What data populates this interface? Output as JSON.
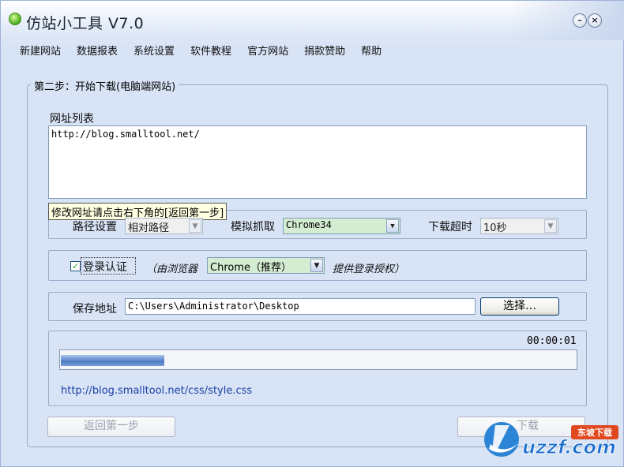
{
  "window": {
    "title": "仿站小工具 V7.0"
  },
  "menu": [
    "新建网站",
    "数据报表",
    "系统设置",
    "软件教程",
    "官方网站",
    "捐款赞助",
    "帮助"
  ],
  "step": {
    "title": "第二步：开始下载(电脑端网站)"
  },
  "url_list": {
    "label": "网址列表",
    "value": "http://blog.smalltool.net/"
  },
  "tooltip": "修改网址请点击右下角的[返回第一步]",
  "settings": {
    "path_label": "路径设置",
    "path_value": "相对路径",
    "crawl_label": "模拟抓取",
    "crawl_value": "Chrome34",
    "timeout_label": "下载超时",
    "timeout_value": "10秒"
  },
  "login": {
    "checked": true,
    "label": "登录认证",
    "hint_left": "（由浏览器",
    "browser_value": "Chrome（推荐）",
    "hint_right": "提供登录授权）"
  },
  "save": {
    "label": "保存地址",
    "value": "C:\\Users\\Administrator\\Desktop",
    "browse_button": "选择…"
  },
  "progress": {
    "elapsed": "00:00:01",
    "percent": 20,
    "current_url": "http://blog.smalltool.net/css/style.css"
  },
  "buttons": {
    "back": "返回第一步",
    "next_partial": "下载"
  },
  "watermark": {
    "text": "uzzf.com",
    "badge": "东坡下载"
  }
}
